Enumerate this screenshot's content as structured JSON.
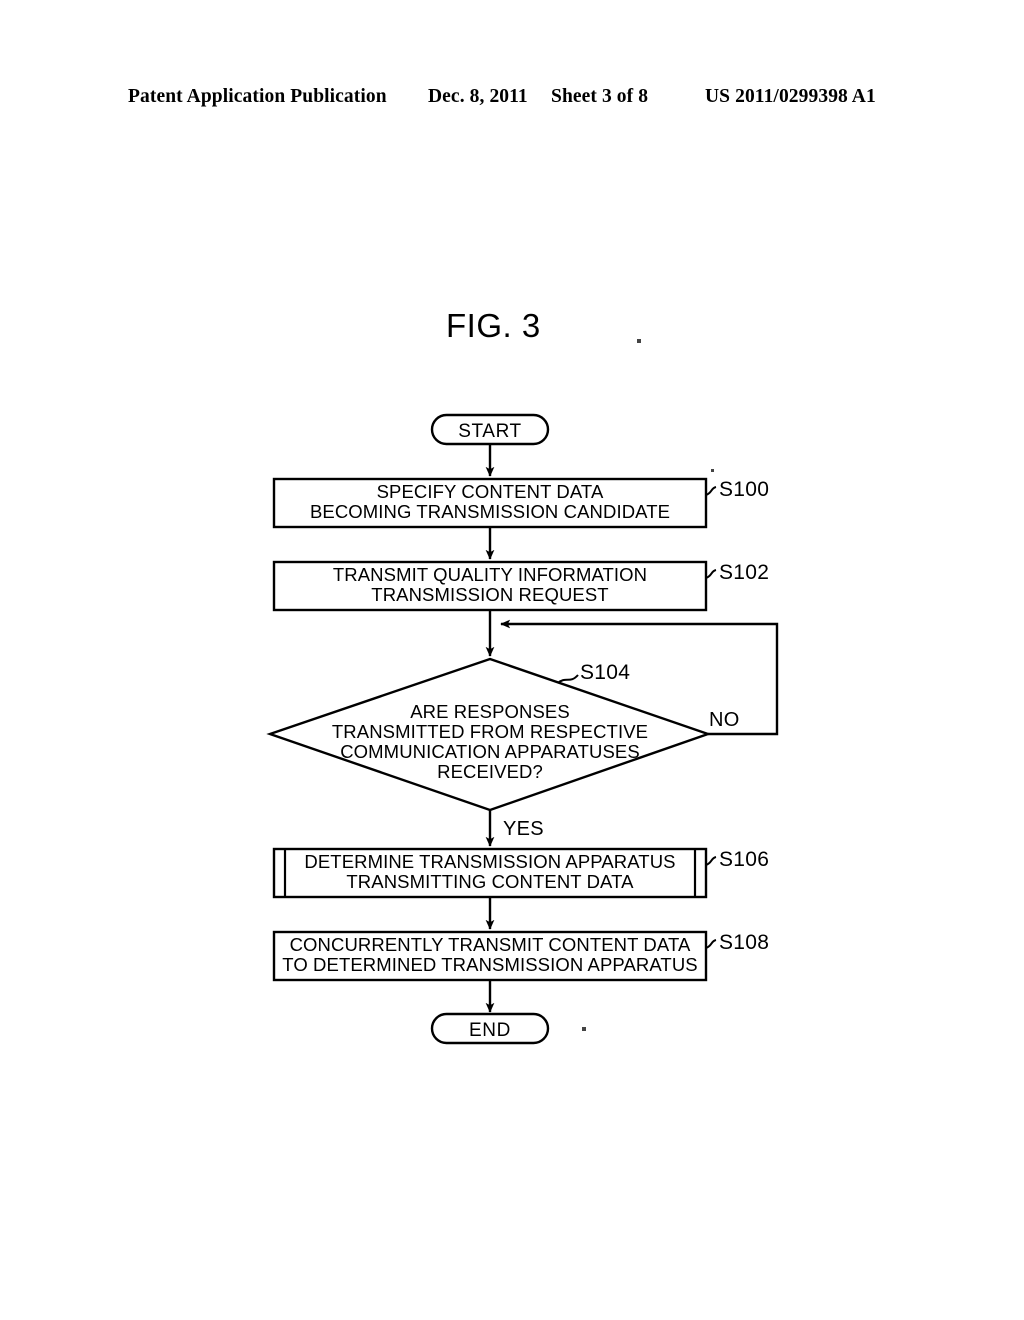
{
  "header": {
    "publication": "Patent Application Publication",
    "date": "Dec. 8, 2011",
    "sheet": "Sheet 3 of 8",
    "patent_number": "US 2011/0299398 A1"
  },
  "figure": {
    "title": "FIG. 3"
  },
  "flowchart": {
    "start_label": "START",
    "end_label": "END",
    "yes_label": "YES",
    "no_label": "NO",
    "steps": [
      {
        "id": "S100",
        "type": "process",
        "lines": [
          "SPECIFY CONTENT DATA",
          "BECOMING TRANSMISSION CANDIDATE"
        ]
      },
      {
        "id": "S102",
        "type": "process",
        "lines": [
          "TRANSMIT QUALITY INFORMATION",
          "TRANSMISSION REQUEST"
        ]
      },
      {
        "id": "S104",
        "type": "decision",
        "lines": [
          "ARE RESPONSES",
          "TRANSMITTED FROM RESPECTIVE",
          "COMMUNICATION APPARATUSES",
          "RECEIVED?"
        ]
      },
      {
        "id": "S106",
        "type": "predefined-process",
        "lines": [
          "DETERMINE TRANSMISSION APPARATUS",
          "TRANSMITTING CONTENT DATA"
        ]
      },
      {
        "id": "S108",
        "type": "process",
        "lines": [
          "CONCURRENTLY TRANSMIT CONTENT DATA",
          "TO DETERMINED TRANSMISSION APPARATUS"
        ]
      }
    ]
  },
  "colors": {
    "ink": "#000000",
    "paper": "#ffffff"
  }
}
